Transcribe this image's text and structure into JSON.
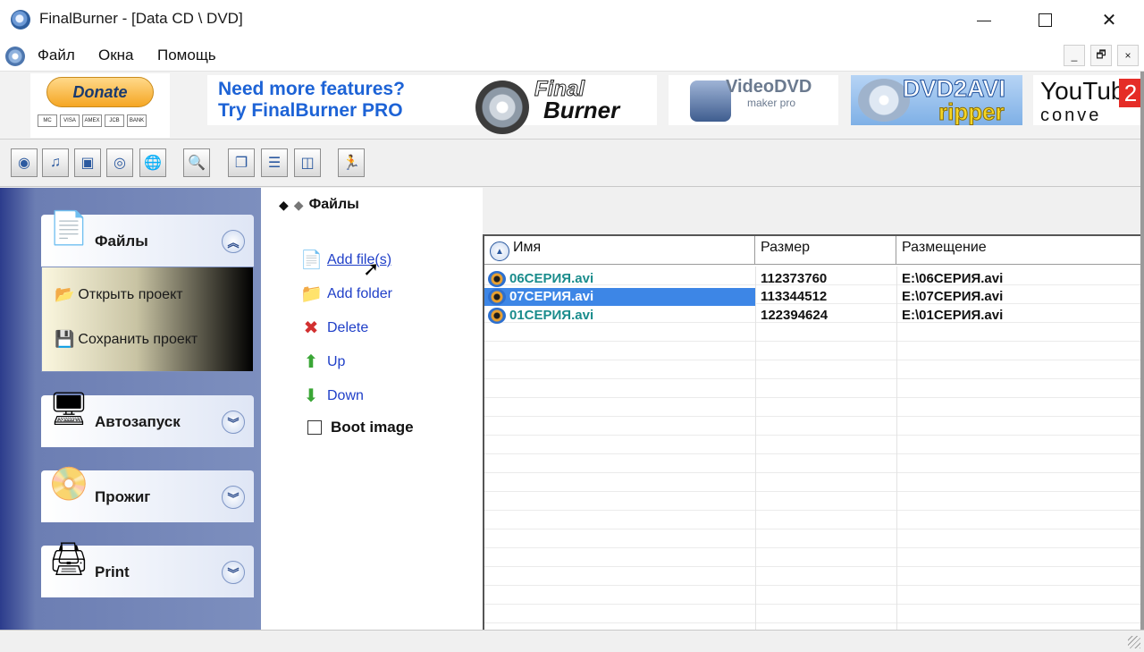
{
  "window": {
    "title": "FinalBurner - [Data CD \\ DVD]",
    "minimize_glyph": "—",
    "maximize_glyph": "☐",
    "close_glyph": "✕"
  },
  "menu": {
    "items": [
      {
        "label": "Файл"
      },
      {
        "label": "Окна"
      },
      {
        "label": "Помощь"
      }
    ],
    "mdi_minimize": "_",
    "mdi_restore": "🗗",
    "mdi_close": "×"
  },
  "banner": {
    "donate_label": "Donate",
    "cards": [
      "MC",
      "VISA",
      "AMEX",
      "JCB",
      "BANK"
    ],
    "finalburner_line1": "Need more features?",
    "finalburner_line2": "Try FinalBurner PRO",
    "finalburner_logo1": "Final",
    "finalburner_logo2": "Burner",
    "videodvd_line1": "VideoDVD",
    "videodvd_line2": "maker pro",
    "dvd2avi_line1": "DVD2AVI",
    "dvd2avi_line2": "ripper",
    "youtube_line1": "YouTube",
    "youtube_badge": "2",
    "youtube_line2": "conve"
  },
  "toolbar": {
    "buttons": [
      {
        "icon": "new-data-disc-icon",
        "glyph": "◉"
      },
      {
        "icon": "new-audio-disc-icon",
        "glyph": "♫"
      },
      {
        "icon": "new-dvd-video-icon",
        "glyph": "▣"
      },
      {
        "icon": "copy-disc-icon",
        "glyph": "◎"
      },
      {
        "icon": "globe-icon",
        "glyph": "🌐"
      },
      {
        "icon": "explore-folder-icon",
        "glyph": "🔍"
      },
      {
        "icon": "cascade-windows-icon",
        "glyph": "❐"
      },
      {
        "icon": "tile-horizontal-icon",
        "glyph": "☰"
      },
      {
        "icon": "tile-vertical-icon",
        "glyph": "◫"
      },
      {
        "icon": "run-icon",
        "glyph": "🏃"
      }
    ]
  },
  "sidebar": {
    "groups": [
      {
        "title": "Файлы",
        "icon": "pages-icon",
        "glyph": "📄",
        "chevron": "︽"
      },
      {
        "title": "Автозапуск",
        "icon": "window-icon",
        "glyph": "🖥",
        "chevron": "︾"
      },
      {
        "title": "Прожиг",
        "icon": "disc-icon",
        "glyph": "📀",
        "chevron": "︾"
      },
      {
        "title": "Print",
        "icon": "printer-icon",
        "glyph": "🖨",
        "chevron": "︾"
      }
    ],
    "tasks": [
      {
        "label": "Открыть проект",
        "icon": "open-folder-icon",
        "glyph": "📂"
      },
      {
        "label": "Сохранить проект",
        "icon": "save-icon",
        "glyph": "💾"
      }
    ]
  },
  "center": {
    "breadcrumb_back": "◆",
    "breadcrumb_forward": "◆",
    "breadcrumb_label": "Файлы",
    "actions": [
      {
        "label": "Add file(s)",
        "icon": "add-file-icon",
        "glyph": "📄"
      },
      {
        "label": "Add folder",
        "icon": "add-folder-icon",
        "glyph": "📁"
      },
      {
        "label": "Delete",
        "icon": "delete-icon",
        "glyph": "✖"
      },
      {
        "label": "Up",
        "icon": "arrow-up-icon",
        "glyph": "⬆"
      },
      {
        "label": "Down",
        "icon": "arrow-down-icon",
        "glyph": "⬇"
      }
    ],
    "boot_image_label": "Boot image",
    "boot_image_checked": false
  },
  "filelist": {
    "sort_glyph": "▲",
    "columns": [
      "Имя",
      "Размер",
      "Размещение"
    ],
    "rows": [
      {
        "name": "06СЕРИЯ.avi",
        "size": "112373760",
        "location": "E:\\06СЕРИЯ.avi",
        "selected": false
      },
      {
        "name": "07СЕРИЯ.avi",
        "size": "113344512",
        "location": "E:\\07СЕРИЯ.avi",
        "selected": true
      },
      {
        "name": "01СЕРИЯ.avi",
        "size": "122394624",
        "location": "E:\\01СЕРИЯ.avi",
        "selected": false
      }
    ]
  },
  "colors": {
    "link": "#1f3fc8",
    "file_name": "#1a8c8c",
    "selection": "#3d86e6",
    "sidebar_dark": "#2c3c8c"
  }
}
